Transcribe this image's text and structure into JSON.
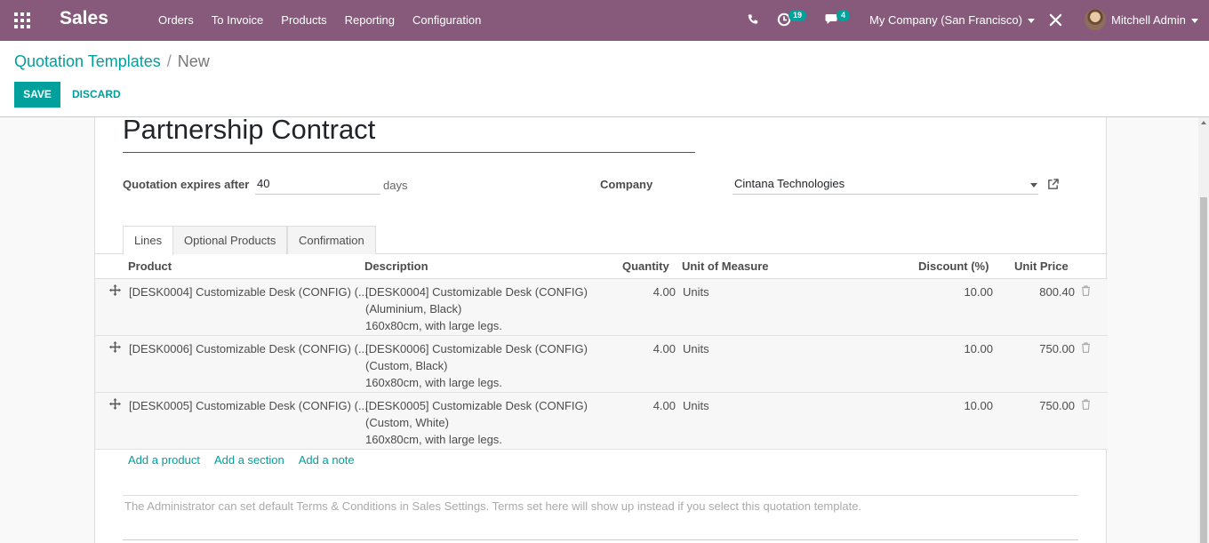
{
  "navbar": {
    "app_name": "Sales",
    "menu": [
      "Orders",
      "To Invoice",
      "Products",
      "Reporting",
      "Configuration"
    ],
    "activity_count": "19",
    "message_count": "4",
    "company": "My Company (San Francisco)",
    "user": "Mitchell Admin",
    "brand_color": "#875a7b"
  },
  "breadcrumb": {
    "parent": "Quotation Templates",
    "separator": "/",
    "current": "New"
  },
  "actions": {
    "save": "SAVE",
    "discard": "DISCARD"
  },
  "form": {
    "name": "Partnership Contract",
    "expires_label": "Quotation expires after",
    "expires_value": "40",
    "expires_unit": "days",
    "company_label": "Company",
    "company_value": "Cintana Technologies"
  },
  "tabs": [
    "Lines",
    "Optional Products",
    "Confirmation"
  ],
  "table": {
    "columns": [
      "Product",
      "Description",
      "Quantity",
      "Unit of Measure",
      "Discount (%)",
      "Unit Price"
    ],
    "rows": [
      {
        "product": "[DESK0004] Customizable Desk (CONFIG) (...",
        "desc1": "[DESK0004] Customizable Desk (CONFIG)",
        "desc2": "(Aluminium, Black)",
        "desc3": "160x80cm, with large legs.",
        "quantity": "4.00",
        "uom": "Units",
        "discount": "10.00",
        "price": "800.40"
      },
      {
        "product": "[DESK0006] Customizable Desk (CONFIG) (...",
        "desc1": "[DESK0006] Customizable Desk (CONFIG)",
        "desc2": "(Custom, Black)",
        "desc3": "160x80cm, with large legs.",
        "quantity": "4.00",
        "uom": "Units",
        "discount": "10.00",
        "price": "750.00"
      },
      {
        "product": "[DESK0005] Customizable Desk (CONFIG) (...",
        "desc1": "[DESK0005] Customizable Desk (CONFIG)",
        "desc2": "(Custom, White)",
        "desc3": "160x80cm, with large legs.",
        "quantity": "4.00",
        "uom": "Units",
        "discount": "10.00",
        "price": "750.00"
      }
    ]
  },
  "add_links": {
    "product": "Add a product",
    "section": "Add a section",
    "note": "Add a note"
  },
  "terms_placeholder": "The Administrator can set default Terms & Conditions in Sales Settings. Terms set here will show up instead if you select this quotation template.",
  "accent_color": "#00a09d"
}
